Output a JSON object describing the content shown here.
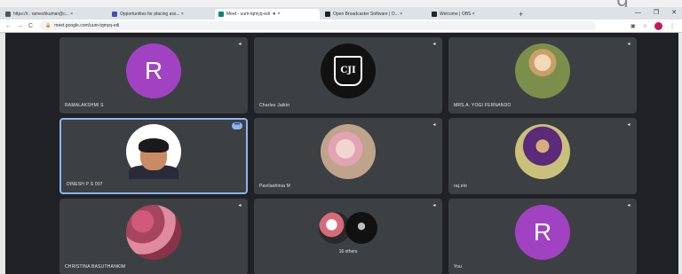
{
  "top_ghost_text": "g",
  "browser": {
    "tabs": [
      {
        "label": "https://r.. rameshkumar@c... ×"
      },
      {
        "label": "Opportunities for placing ass... ×"
      },
      {
        "label": "Meet - uum-tqmyq-edi"
      },
      {
        "label": "Open Broadcaster Software | O... ×"
      },
      {
        "label": "Welcome | OBS ×"
      }
    ],
    "new_tab": "+",
    "window_controls": [
      "—",
      "❐",
      "✕"
    ],
    "nav": {
      "back": "←",
      "forward": "→",
      "reload": "C"
    },
    "url": "meet.google.com/uum-tqmyq-edi",
    "lock": "🔒"
  },
  "meeting": {
    "tiles": [
      {
        "name": "RAMALAKSHMI S",
        "kind": "letter",
        "letter": "R",
        "speaking": false
      },
      {
        "name": "Charles Jaikin",
        "kind": "logo",
        "logo_text": "CJI",
        "speaking": false
      },
      {
        "name": "MRS.A. YOGI FERNANDO",
        "kind": "photo-1",
        "speaking": false
      },
      {
        "name": "DINESH P S 007",
        "kind": "photo-2",
        "speaking": true
      },
      {
        "name": "Pavilashinia M",
        "kind": "photo-3",
        "speaking": false
      },
      {
        "name": "raj.elo",
        "kind": "photo-4",
        "speaking": false
      },
      {
        "name": "CHRISTINA BASUTHANKIM",
        "kind": "photo-5",
        "speaking": false
      },
      {
        "name": "16 others",
        "kind": "others",
        "speaking": false
      },
      {
        "name": "You",
        "kind": "letter",
        "letter": "R",
        "speaking": false
      }
    ]
  },
  "colors": {
    "meet_bg": "#202124",
    "tile_bg": "#3c4043",
    "letter_avatar": "#a142c3",
    "speaking_border": "#8ab4f8"
  }
}
